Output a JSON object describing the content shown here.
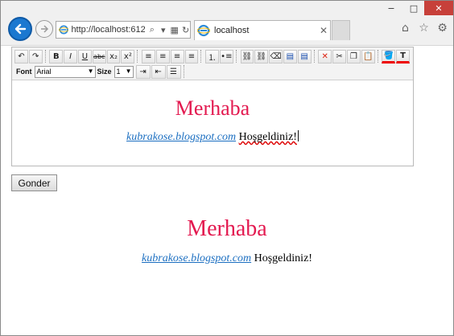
{
  "browser": {
    "address": "http://localhost:612",
    "tab_title": "localhost",
    "window_controls": {
      "minimize": "−",
      "maximize": "□",
      "close": "✕"
    }
  },
  "toolbar": {
    "row1": [
      {
        "name": "undo-button",
        "glyph": "↶"
      },
      {
        "name": "redo-button",
        "glyph": "↷"
      },
      {
        "name": "bold-button",
        "glyph": "B"
      },
      {
        "name": "italic-button",
        "glyph": "I"
      },
      {
        "name": "underline-button",
        "glyph": "U"
      },
      {
        "name": "strikethrough-button",
        "glyph": "abc"
      },
      {
        "name": "subscript-button",
        "glyph": "x₂"
      },
      {
        "name": "superscript-button",
        "glyph": "x²"
      },
      {
        "name": "align-left-button",
        "glyph": "≡"
      },
      {
        "name": "align-center-button",
        "glyph": "≡"
      },
      {
        "name": "align-right-button",
        "glyph": "≡"
      },
      {
        "name": "justify-button",
        "glyph": "≡"
      },
      {
        "name": "ordered-list-button",
        "glyph": "⒈"
      },
      {
        "name": "unordered-list-button",
        "glyph": "•≡"
      },
      {
        "name": "insert-link-button",
        "glyph": "⛓"
      },
      {
        "name": "remove-link-button",
        "glyph": "⛓"
      },
      {
        "name": "eraser-button",
        "glyph": "⌫"
      },
      {
        "name": "select-all-button",
        "glyph": "▤"
      },
      {
        "name": "remove-format-button",
        "glyph": "▤"
      },
      {
        "name": "delete-button",
        "glyph": "✕"
      },
      {
        "name": "cut-button",
        "glyph": "✂"
      },
      {
        "name": "copy-button",
        "glyph": "❐"
      },
      {
        "name": "paste-button",
        "glyph": "📋"
      },
      {
        "name": "back-color-button",
        "glyph": "🪣"
      },
      {
        "name": "fore-color-button",
        "glyph": "T"
      }
    ],
    "font_label": "Font",
    "font_value": "Arial",
    "size_label": "Size",
    "size_value": "1"
  },
  "editor": {
    "heading": "Merhaba",
    "link_text": "kubrakose.blogspot.com",
    "welcome_text": "Hoşgeldiniz!"
  },
  "submit_label": "Gonder",
  "output": {
    "heading": "Merhaba",
    "link_text": "kubrakose.blogspot.com",
    "welcome_text": "Hoşgeldiniz!"
  },
  "colors": {
    "heading": "#e31a50",
    "link": "#1c6fc1",
    "back_button": "#1b78d0",
    "close_button": "#c7403a"
  }
}
